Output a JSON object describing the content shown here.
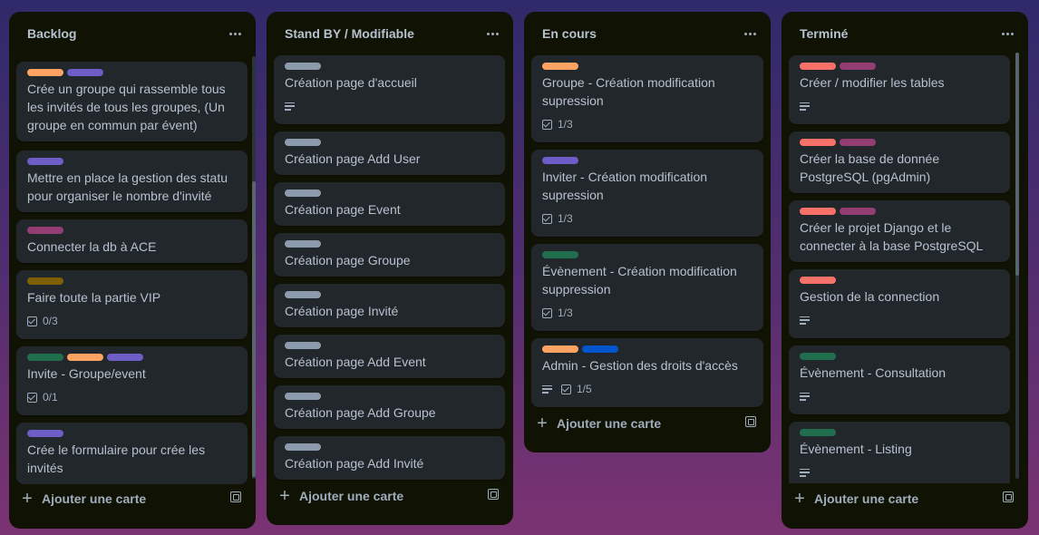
{
  "colors": {
    "orange": "#fea362",
    "purple": "#6e5dc6",
    "magenta": "#943d73",
    "olive": "#7f5f01",
    "green": "#216e4e",
    "blue": "#0055cc",
    "gray": "#8c9bab",
    "red": "#f87168"
  },
  "icons": {
    "menu": "ellipsis-icon",
    "add": "plus-icon",
    "template": "template-icon",
    "description": "description-icon",
    "checklist": "checklist-icon"
  },
  "lists": [
    {
      "title": "Backlog",
      "add_label": "Ajouter une carte",
      "cards": [
        {
          "labels": [
            "orange",
            "purple"
          ],
          "title": "Crée un groupe qui rassemble tous les invités de tous les groupes, (Un groupe en commun par évent)"
        },
        {
          "labels": [
            "purple"
          ],
          "title": "Mettre en place la gestion des statu pour organiser le nombre d'invité"
        },
        {
          "labels": [
            "magenta"
          ],
          "title": "Connecter la db à ACE"
        },
        {
          "labels": [
            "olive"
          ],
          "title": "Faire toute la partie VIP",
          "checklist": "0/3"
        },
        {
          "labels": [
            "green",
            "orange",
            "purple"
          ],
          "title": "Invite - Groupe/event",
          "checklist": "0/1"
        },
        {
          "labels": [
            "purple"
          ],
          "title": "Crée le formulaire pour crée les invités"
        }
      ]
    },
    {
      "title": "Stand BY / Modifiable",
      "add_label": "Ajouter une carte",
      "cards": [
        {
          "labels": [
            "gray"
          ],
          "title": "Création page d'accueil",
          "description": true
        },
        {
          "labels": [
            "gray"
          ],
          "title": "Création page Add User"
        },
        {
          "labels": [
            "gray"
          ],
          "title": "Création page Event"
        },
        {
          "labels": [
            "gray"
          ],
          "title": "Création page Groupe"
        },
        {
          "labels": [
            "gray"
          ],
          "title": "Création page Invité"
        },
        {
          "labels": [
            "gray"
          ],
          "title": "Création page Add Event"
        },
        {
          "labels": [
            "gray"
          ],
          "title": "Création page Add Groupe"
        },
        {
          "labels": [
            "gray"
          ],
          "title": "Création page Add Invité"
        }
      ]
    },
    {
      "title": "En cours",
      "add_label": "Ajouter une carte",
      "cards": [
        {
          "labels": [
            "orange"
          ],
          "title": "Groupe - Création modification supression",
          "checklist": "1/3"
        },
        {
          "labels": [
            "purple"
          ],
          "title": "Inviter - Création modification supression",
          "checklist": "1/3"
        },
        {
          "labels": [
            "green"
          ],
          "title": "Évènement - Création modification suppression",
          "checklist": "1/3"
        },
        {
          "labels": [
            "orange",
            "blue"
          ],
          "title": "Admin - Gestion des droits d'accès",
          "description": true,
          "checklist": "1/5"
        }
      ]
    },
    {
      "title": "Terminé",
      "add_label": "Ajouter une carte",
      "cards": [
        {
          "labels": [
            "red",
            "magenta"
          ],
          "title": "Créer / modifier les tables",
          "description": true
        },
        {
          "labels": [
            "red",
            "magenta"
          ],
          "title": "Créer la base de donnée PostgreSQL (pgAdmin)"
        },
        {
          "labels": [
            "red",
            "magenta"
          ],
          "title": "Créer le projet Django et le connecter à la base PostgreSQL"
        },
        {
          "labels": [
            "red"
          ],
          "title": "Gestion de la connection",
          "description": true
        },
        {
          "labels": [
            "green"
          ],
          "title": "Évènement - Consultation",
          "description": true
        },
        {
          "labels": [
            "green"
          ],
          "title": "Évènement - Listing",
          "description": true
        }
      ]
    }
  ]
}
